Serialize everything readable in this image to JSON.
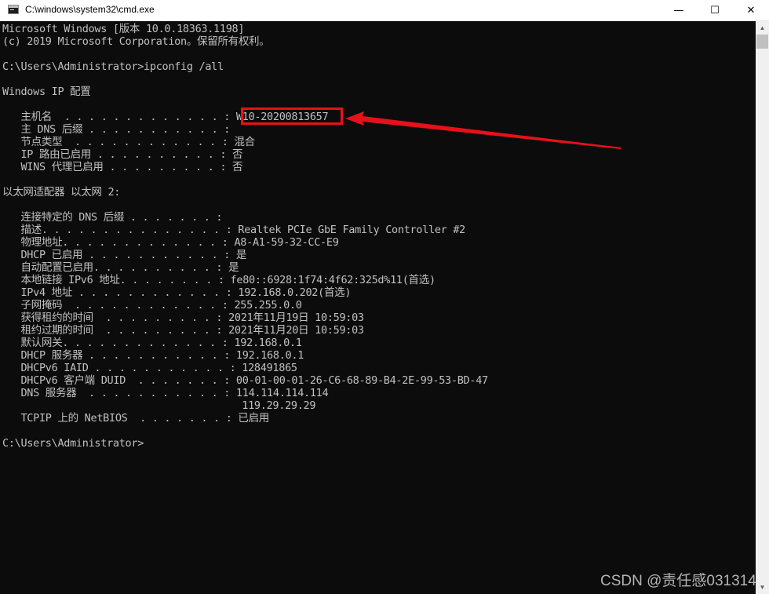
{
  "window": {
    "title": "C:\\windows\\system32\\cmd.exe",
    "app_icon": "cmd-icon",
    "controls": {
      "minimize": "—",
      "maximize": "☐",
      "close": "✕"
    }
  },
  "console": {
    "lines": [
      "Microsoft Windows [版本 10.0.18363.1198]",
      "(c) 2019 Microsoft Corporation。保留所有权利。",
      "",
      "C:\\Users\\Administrator>ipconfig /all",
      "",
      "Windows IP 配置",
      "",
      "   主机名  . . . . . . . . . . . . . : W10-20200813657",
      "   主 DNS 后缀 . . . . . . . . . . . :",
      "   节点类型  . . . . . . . . . . . . : 混合",
      "   IP 路由已启用 . . . . . . . . . . : 否",
      "   WINS 代理已启用 . . . . . . . . . : 否",
      "",
      "以太网适配器 以太网 2:",
      "",
      "   连接特定的 DNS 后缀 . . . . . . . :",
      "   描述. . . . . . . . . . . . . . . : Realtek PCIe GbE Family Controller #2",
      "   物理地址. . . . . . . . . . . . . : A8-A1-59-32-CC-E9",
      "   DHCP 已启用 . . . . . . . . . . . : 是",
      "   自动配置已启用. . . . . . . . . . : 是",
      "   本地链接 IPv6 地址. . . . . . . . : fe80::6928:1f74:4f62:325d%11(首选)",
      "   IPv4 地址 . . . . . . . . . . . . : 192.168.0.202(首选)",
      "   子网掩码  . . . . . . . . . . . . : 255.255.0.0",
      "   获得租约的时间  . . . . . . . . . : 2021年11月19日 10:59:03",
      "   租约过期的时间  . . . . . . . . . : 2021年11月20日 10:59:03",
      "   默认网关. . . . . . . . . . . . . : 192.168.0.1",
      "   DHCP 服务器 . . . . . . . . . . . : 192.168.0.1",
      "   DHCPv6 IAID . . . . . . . . . . . : 128491865",
      "   DHCPv6 客户端 DUID  . . . . . . . : 00-01-00-01-26-C6-68-89-B4-2E-99-53-BD-47",
      "   DNS 服务器  . . . . . . . . . . . : 114.114.114.114",
      "                                       119.29.29.29",
      "   TCPIP 上的 NetBIOS  . . . . . . . : 已启用",
      "",
      "C:\\Users\\Administrator>"
    ]
  },
  "annotation": {
    "highlight_color": "#e8101a",
    "highlighted_value": "W10-20200813657"
  },
  "watermark": "CSDN @责任感031314"
}
